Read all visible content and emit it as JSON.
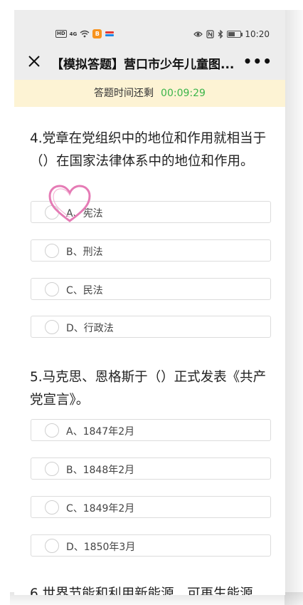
{
  "statusbar": {
    "network_badge": "HD",
    "signal": "4G",
    "app_icon_text": "B",
    "time": "10:20",
    "battery_level": 0.55
  },
  "navbar": {
    "title": "【模拟答题】营口市少年儿童图..."
  },
  "timer": {
    "label": "答题时间还剩",
    "value": "00:09:29"
  },
  "questions": [
    {
      "text": "4.党章在党组织中的地位和作用就相当于（）在国家法律体系中的地位和作用。",
      "options": [
        "A、宪法",
        "B、刑法",
        "C、民法",
        "D、行政法"
      ]
    },
    {
      "text": "5.马克思、恩格斯于（）正式发表《共产党宣言》。",
      "options": [
        "A、1847年2月",
        "B、1848年2月",
        "C、1849年2月",
        "D、1850年3月"
      ]
    },
    {
      "text": "6.世界节能和利用新能源、可再生能源"
    }
  ],
  "colors": {
    "timer_bg": "#fdf3d4",
    "timer_value": "#3bb54a",
    "heart": "#e57bb5"
  }
}
